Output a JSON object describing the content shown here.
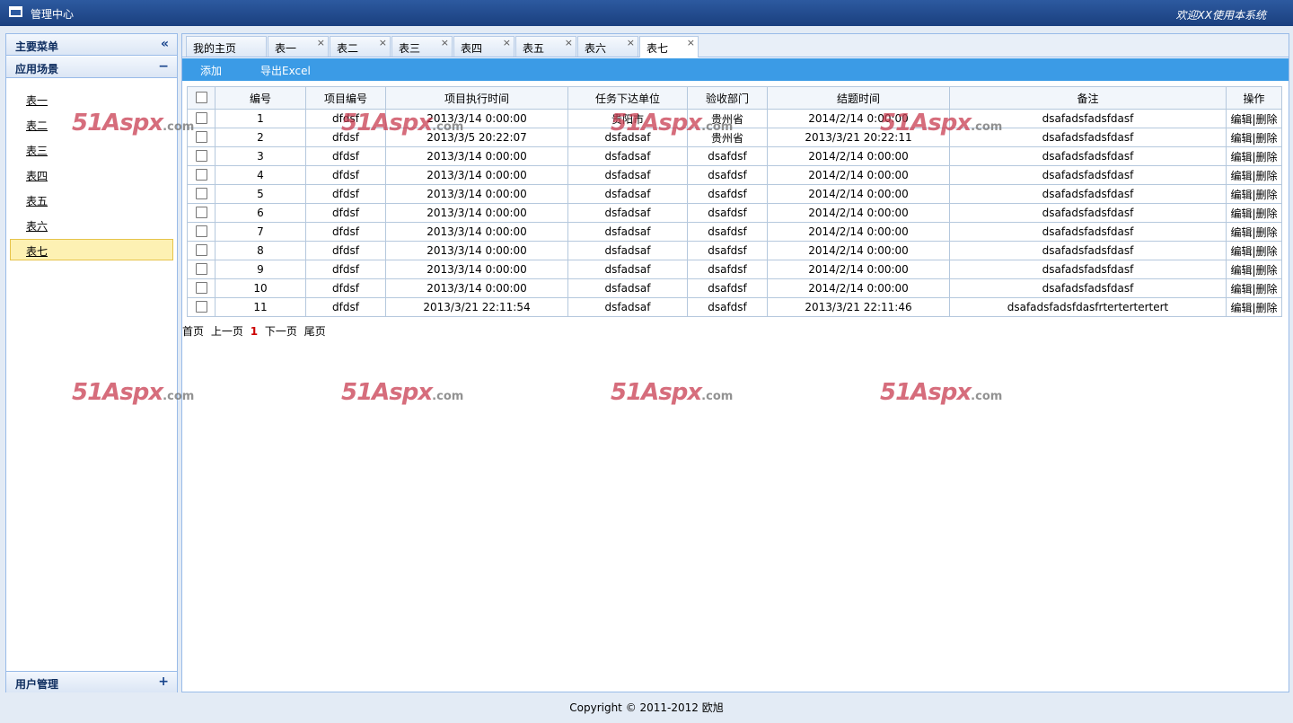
{
  "header": {
    "title": "管理中心",
    "welcome": "欢迎XX使用本系统"
  },
  "sidebar": {
    "main_menu": {
      "label": "主要菜单",
      "tool": "«"
    },
    "section": {
      "label": "应用场景",
      "tool": "−"
    },
    "items": [
      {
        "label": "表一"
      },
      {
        "label": "表二"
      },
      {
        "label": "表三"
      },
      {
        "label": "表四"
      },
      {
        "label": "表五"
      },
      {
        "label": "表六"
      },
      {
        "label": "表七"
      }
    ],
    "selected_index": 6,
    "user_mgmt": {
      "label": "用户管理",
      "tool": "+"
    }
  },
  "tabs": [
    {
      "label": "我的主页"
    },
    {
      "label": "表一",
      "close": "×"
    },
    {
      "label": "表二",
      "close": "×"
    },
    {
      "label": "表三",
      "close": "×"
    },
    {
      "label": "表四",
      "close": "×"
    },
    {
      "label": "表五",
      "close": "×"
    },
    {
      "label": "表六",
      "close": "×"
    },
    {
      "label": "表七",
      "close": "×"
    }
  ],
  "toolbar": {
    "add": "添加",
    "export": "导出Excel"
  },
  "table": {
    "columns": [
      "编号",
      "项目编号",
      "项目执行时间",
      "任务下达单位",
      "验收部门",
      "结题时间",
      "备注",
      "操作"
    ],
    "edit_label": "编辑",
    "sep": "|",
    "delete_label": "删除",
    "rows": [
      [
        "1",
        "dfdsf",
        "2013/3/14 0:00:00",
        "贵阳市",
        "贵州省",
        "2014/2/14 0:00:00",
        "dsafadsfadsfdasf"
      ],
      [
        "2",
        "dfdsf",
        "2013/3/5 20:22:07",
        "dsfadsaf",
        "贵州省",
        "2013/3/21 20:22:11",
        "dsafadsfadsfdasf"
      ],
      [
        "3",
        "dfdsf",
        "2013/3/14 0:00:00",
        "dsfadsaf",
        "dsafdsf",
        "2014/2/14 0:00:00",
        "dsafadsfadsfdasf"
      ],
      [
        "4",
        "dfdsf",
        "2013/3/14 0:00:00",
        "dsfadsaf",
        "dsafdsf",
        "2014/2/14 0:00:00",
        "dsafadsfadsfdasf"
      ],
      [
        "5",
        "dfdsf",
        "2013/3/14 0:00:00",
        "dsfadsaf",
        "dsafdsf",
        "2014/2/14 0:00:00",
        "dsafadsfadsfdasf"
      ],
      [
        "6",
        "dfdsf",
        "2013/3/14 0:00:00",
        "dsfadsaf",
        "dsafdsf",
        "2014/2/14 0:00:00",
        "dsafadsfadsfdasf"
      ],
      [
        "7",
        "dfdsf",
        "2013/3/14 0:00:00",
        "dsfadsaf",
        "dsafdsf",
        "2014/2/14 0:00:00",
        "dsafadsfadsfdasf"
      ],
      [
        "8",
        "dfdsf",
        "2013/3/14 0:00:00",
        "dsfadsaf",
        "dsafdsf",
        "2014/2/14 0:00:00",
        "dsafadsfadsfdasf"
      ],
      [
        "9",
        "dfdsf",
        "2013/3/14 0:00:00",
        "dsfadsaf",
        "dsafdsf",
        "2014/2/14 0:00:00",
        "dsafadsfadsfdasf"
      ],
      [
        "10",
        "dfdsf",
        "2013/3/14 0:00:00",
        "dsfadsaf",
        "dsafdsf",
        "2014/2/14 0:00:00",
        "dsafadsfadsfdasf"
      ],
      [
        "11",
        "dfdsf",
        "2013/3/21 22:11:54",
        "dsfadsaf",
        "dsafdsf",
        "2013/3/21 22:11:46",
        "dsafadsfadsfdasfrtertertertert"
      ]
    ]
  },
  "pager": {
    "first": "首页",
    "prev": "上一页",
    "current": "1",
    "next": "下一页",
    "last": "尾页"
  },
  "watermark": {
    "text": "51Aspx",
    "suffix": ".com"
  },
  "footer": {
    "copyright": "Copyright © 2011-2012 欧旭"
  }
}
